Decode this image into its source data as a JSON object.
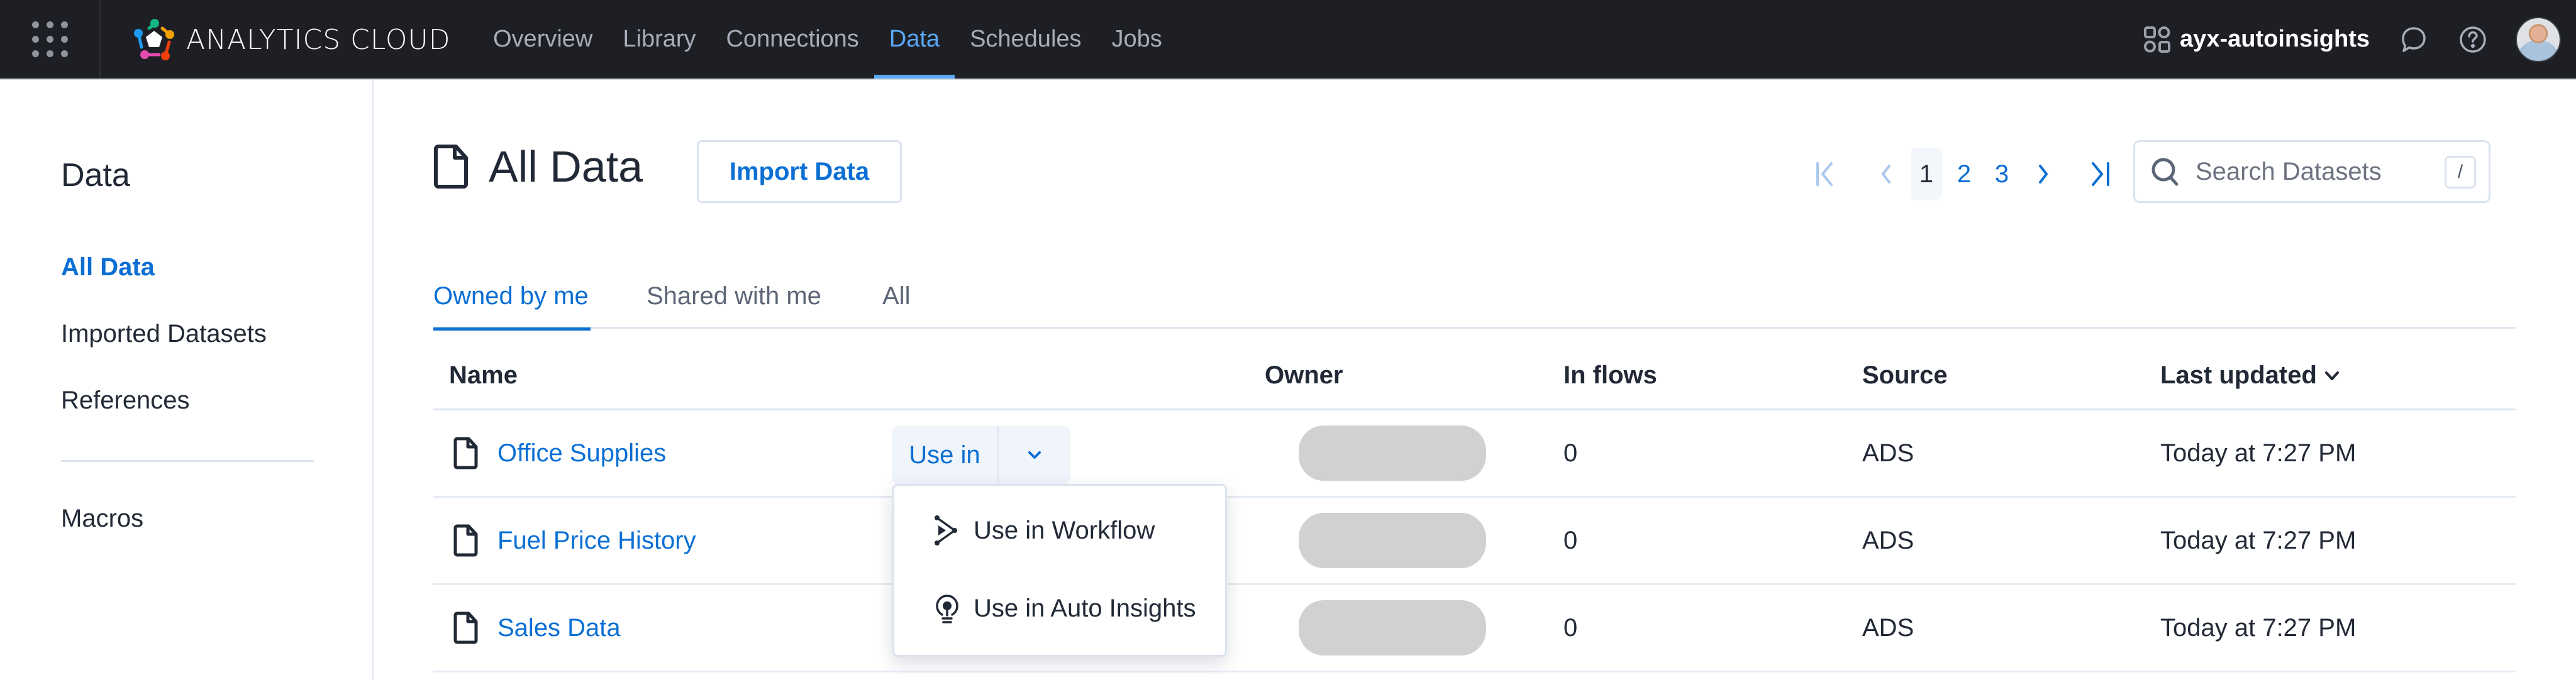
{
  "topbar": {
    "brand": "ANALYTICS CLOUD",
    "nav": [
      {
        "label": "Overview",
        "active": false
      },
      {
        "label": "Library",
        "active": false
      },
      {
        "label": "Connections",
        "active": false
      },
      {
        "label": "Data",
        "active": true
      },
      {
        "label": "Schedules",
        "active": false
      },
      {
        "label": "Jobs",
        "active": false
      }
    ],
    "workspace": "ayx-autoinsights",
    "icons": {
      "apps": "apps-grid-icon",
      "workspace": "workspace-icon",
      "chat": "chat-icon",
      "help": "help-icon",
      "avatar": "user-avatar"
    }
  },
  "sidebar": {
    "title": "Data",
    "items": [
      {
        "label": "All Data",
        "active": true
      },
      {
        "label": "Imported Datasets",
        "active": false
      },
      {
        "label": "References",
        "active": false
      },
      {
        "label": "Macros",
        "active": false
      }
    ]
  },
  "main": {
    "title": "All Data",
    "import_label": "Import Data",
    "pagination": {
      "pages": [
        "1",
        "2",
        "3"
      ],
      "current": "1"
    },
    "search": {
      "placeholder": "Search Datasets",
      "value": "",
      "shortcut": "/"
    },
    "tabs": [
      {
        "label": "Owned by me",
        "active": true
      },
      {
        "label": "Shared with me",
        "active": false
      },
      {
        "label": "All",
        "active": false
      }
    ],
    "table": {
      "columns": [
        "Name",
        "Owner",
        "In flows",
        "Source",
        "Last updated"
      ],
      "sort_column": "Last updated",
      "sort_direction": "descending",
      "rows": [
        {
          "name": "Office Supplies",
          "owner": "",
          "in_flows": "0",
          "source": "ADS",
          "last_updated": "Today at 7:27 PM"
        },
        {
          "name": "Fuel Price History",
          "owner": "",
          "in_flows": "0",
          "source": "ADS",
          "last_updated": "Today at 7:27 PM"
        },
        {
          "name": "Sales Data",
          "owner": "",
          "in_flows": "0",
          "source": "ADS",
          "last_updated": "Today at 7:27 PM"
        }
      ]
    },
    "use_in": {
      "label": "Use in",
      "menu": [
        {
          "label": "Use in Workflow",
          "icon": "workflow-icon"
        },
        {
          "label": "Use in Auto Insights",
          "icon": "lightbulb-icon"
        }
      ]
    }
  },
  "colors": {
    "topbar_bg": "#1e1f24",
    "accent": "#0b6fd4",
    "nav_active": "#5aa7f5",
    "text": "#222936",
    "border": "#dde5f0"
  }
}
